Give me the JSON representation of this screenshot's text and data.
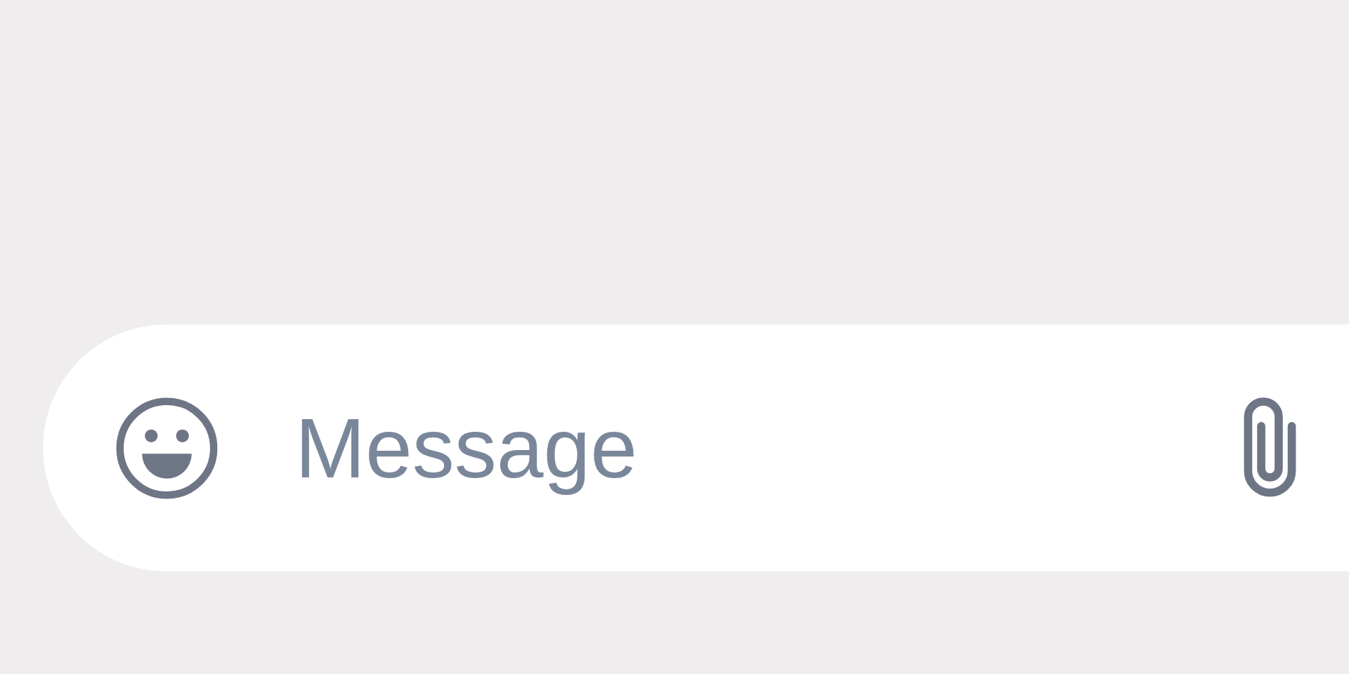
{
  "composer": {
    "placeholder": "Message"
  }
}
